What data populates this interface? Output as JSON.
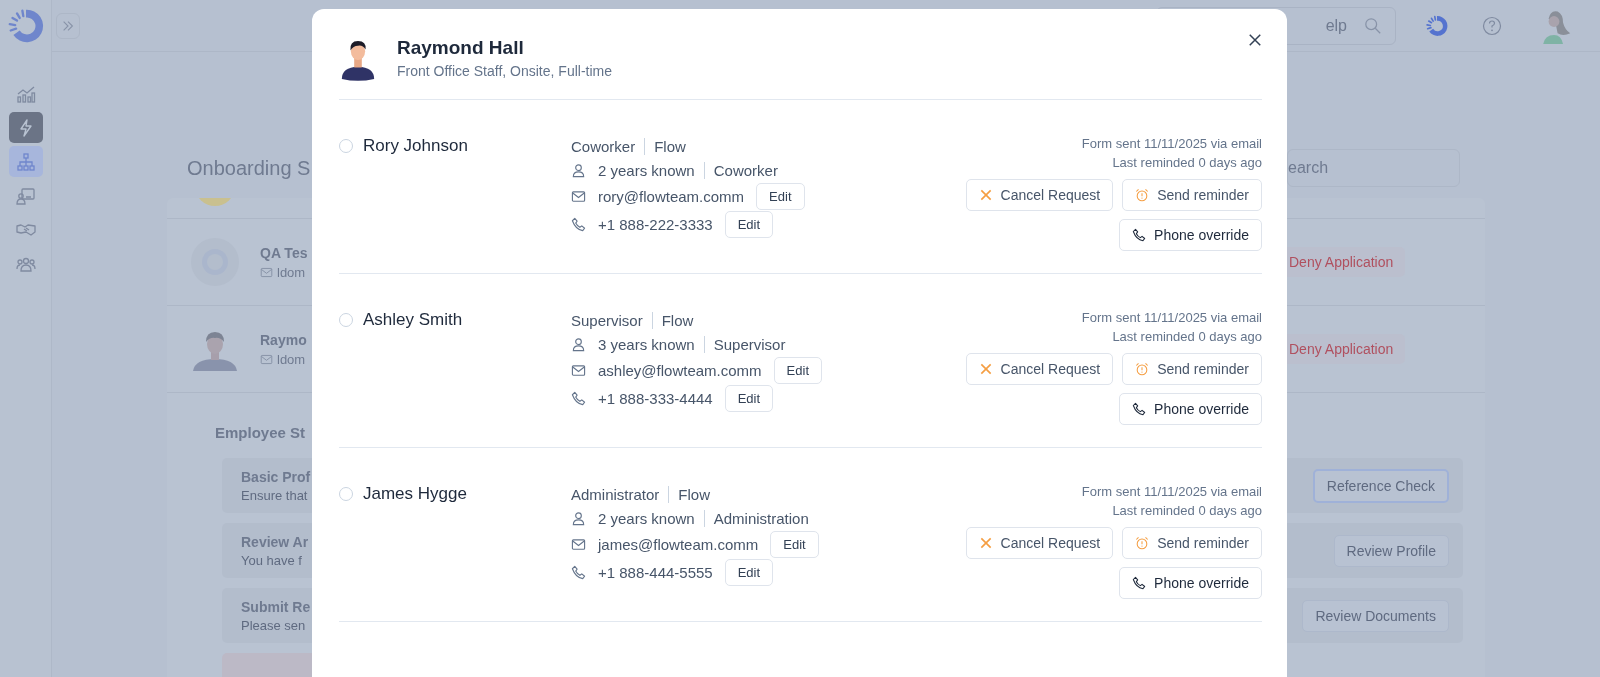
{
  "sidebar": {
    "items": [
      {
        "kind": "chart",
        "selected": false,
        "highlighted": false
      },
      {
        "kind": "bolt",
        "selected": false,
        "highlighted": true
      },
      {
        "kind": "org",
        "selected": true,
        "highlighted": false
      },
      {
        "kind": "presentation",
        "selected": false,
        "highlighted": false
      },
      {
        "kind": "handshake",
        "selected": false,
        "highlighted": false
      },
      {
        "kind": "team",
        "selected": false,
        "highlighted": false
      }
    ]
  },
  "header": {
    "search_placeholder": "elp"
  },
  "background": {
    "title": "Onboarding S",
    "search_placeholder": "earch",
    "applicants": [
      {
        "kind": "logo",
        "name": "QA Tes",
        "email": "ldom",
        "action": "Deny Application"
      },
      {
        "kind": "person",
        "name": "Raymo",
        "email": "ldom",
        "action": "Deny Application"
      }
    ],
    "steps_title": "Employee St",
    "steps": [
      {
        "title": "Basic Prof",
        "description": "Ensure that",
        "action": "Reference Check",
        "focused": true
      },
      {
        "title": "Review Ar",
        "description": "You have f",
        "action": "Review Profile",
        "focused": false
      },
      {
        "title": "Submit Re",
        "description": "Please sen",
        "action": "Review Documents",
        "focused": false
      }
    ]
  },
  "modal": {
    "name": "Raymond Hall",
    "subtitle": "Front Office Staff, Onsite, Full-time",
    "references": [
      {
        "name": "Rory Johnson",
        "selected": false,
        "relation": "Coworker",
        "company": "Flow",
        "years": "2 years known",
        "role": "Coworker",
        "email": "rory@flowteam.comm",
        "email_edit": "Edit",
        "phone": "+1 888-222-3333",
        "phone_edit": "Edit",
        "form_sent": "Form sent 11/11/2025 via email",
        "last_reminded": "Last reminded 0 days ago",
        "actions": [
          {
            "kind": "cancel",
            "label": "Cancel Request"
          },
          {
            "kind": "remind",
            "label": "Send reminder"
          },
          {
            "kind": "phone",
            "label": "Phone override"
          }
        ]
      },
      {
        "name": "Ashley Smith",
        "selected": false,
        "relation": "Supervisor",
        "company": "Flow",
        "years": "3 years known",
        "role": "Supervisor",
        "email": "ashley@flowteam.comm",
        "email_edit": "Edit",
        "phone": "+1 888-333-4444",
        "phone_edit": "Edit",
        "form_sent": "Form sent 11/11/2025 via email",
        "last_reminded": "Last reminded 0 days ago",
        "actions": [
          {
            "kind": "cancel",
            "label": "Cancel Request"
          },
          {
            "kind": "remind",
            "label": "Send reminder"
          },
          {
            "kind": "phone",
            "label": "Phone override"
          }
        ]
      },
      {
        "name": "James Hygge",
        "selected": false,
        "relation": "Administrator",
        "company": "Flow",
        "years": "2 years known",
        "role": "Administration",
        "email": "james@flowteam.comm",
        "email_edit": "Edit",
        "phone": "+1 888-444-5555",
        "phone_edit": "Edit",
        "form_sent": "Form sent 11/11/2025 via email",
        "last_reminded": "Last reminded 0 days ago",
        "actions": [
          {
            "kind": "cancel",
            "label": "Cancel Request"
          },
          {
            "kind": "remind",
            "label": "Send reminder"
          },
          {
            "kind": "phone",
            "label": "Phone override"
          }
        ]
      }
    ]
  }
}
